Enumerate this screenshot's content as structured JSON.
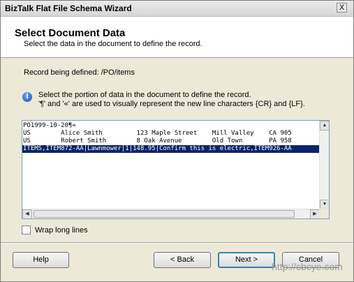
{
  "window": {
    "title": "BizTalk Flat File Schema Wizard",
    "close_glyph": "X"
  },
  "header": {
    "title": "Select Document Data",
    "subtitle": "Select the data in the document to define the record."
  },
  "record": {
    "label": "Record being defined: /PO/items"
  },
  "info": {
    "line1": "Select the portion of data in the document to define the record.",
    "line2": "'¶' and '«' are used to visually represent the new line characters {CR} and {LF}."
  },
  "document": {
    "lines": [
      "PO1999-10-20¶«",
      "US        Alice Smith         123 Maple Street    Mill Valley    CA 905",
      "US        Robert Smith        8 Oak Avenue        Old Town       PA 958",
      "ITEMS,ITEM872-AA|Lawnmower|1|148.95|Confirm this is electric,ITEM926-AA"
    ],
    "selected_line_index": 3
  },
  "options": {
    "wrap_label": "Wrap long lines",
    "wrap_checked": false
  },
  "buttons": {
    "help": "Help",
    "back": "< Back",
    "next": "Next >",
    "cancel": "Cancel"
  },
  "watermark": "http://cbcye.com"
}
